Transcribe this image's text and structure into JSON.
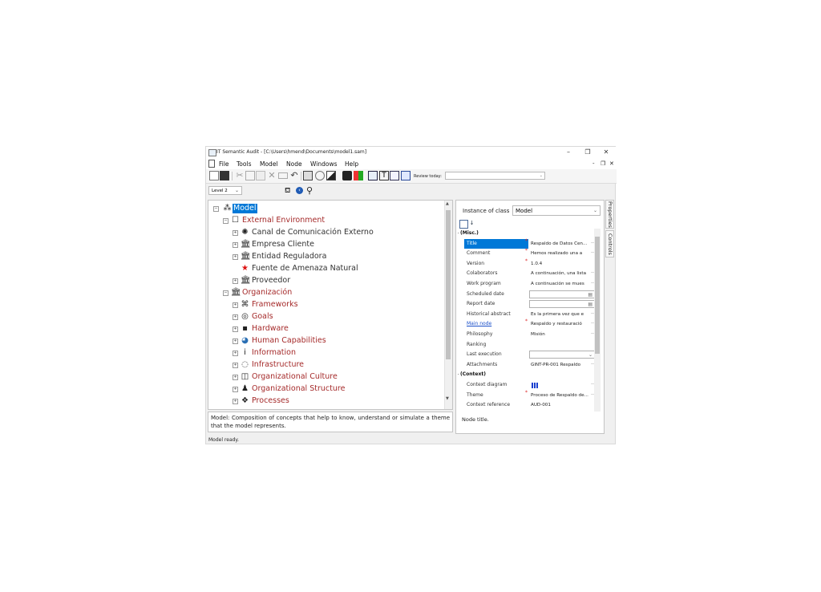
{
  "window": {
    "title": "IT Semantic Audit - [C:\\Users\\hmend\\Documents\\model1.sam]",
    "minimize": "–",
    "restore": "❐",
    "close": "✕"
  },
  "menu": {
    "items": [
      "File",
      "Tools",
      "Model",
      "Node",
      "Windows",
      "Help"
    ],
    "mdi_min": "-",
    "mdi_restore": "❐",
    "mdi_close": "✕"
  },
  "toolbar": {
    "review_label": "Review today:",
    "review_value": ""
  },
  "search": {
    "level": "Level 2"
  },
  "tree": {
    "nodes": [
      {
        "label": "Model",
        "icon": "model-icon",
        "style": "sel"
      },
      {
        "label": "External Environment",
        "icon": "external-env-icon",
        "style": "red"
      },
      {
        "label": "Canal de Comunicación Externo",
        "icon": "communication-channel-icon",
        "style": "dark"
      },
      {
        "label": "Empresa Cliente",
        "icon": "institution-icon",
        "style": "dark"
      },
      {
        "label": "Entidad Reguladora",
        "icon": "institution-icon",
        "style": "dark"
      },
      {
        "label": "Fuente de Amenaza Natural",
        "icon": "star-icon",
        "style": "dark"
      },
      {
        "label": "Proveedor",
        "icon": "institution-icon",
        "style": "dark"
      },
      {
        "label": "Organización",
        "icon": "institution-icon",
        "style": "red"
      },
      {
        "label": "Frameworks",
        "icon": "frameworks-icon",
        "style": "red"
      },
      {
        "label": "Goals",
        "icon": "target-icon",
        "style": "red"
      },
      {
        "label": "Hardware",
        "icon": "hardware-icon",
        "style": "red"
      },
      {
        "label": "Human Capabilities",
        "icon": "human-head-icon",
        "style": "red"
      },
      {
        "label": "Information",
        "icon": "info-icon",
        "style": "red"
      },
      {
        "label": "Infrastructure",
        "icon": "infrastructure-icon",
        "style": "red"
      },
      {
        "label": "Organizational Culture",
        "icon": "culture-icon",
        "style": "red"
      },
      {
        "label": "Organizational Structure",
        "icon": "org-chart-icon",
        "style": "red"
      },
      {
        "label": "Processes",
        "icon": "processes-icon",
        "style": "red"
      }
    ]
  },
  "description": {
    "text": "Model: Composition of concepts that help to know, understand or simulate a theme that the model represents."
  },
  "status": {
    "text": "Model ready."
  },
  "properties": {
    "instance_label": "Instance of class",
    "instance_value": "Model",
    "categories": {
      "misc": "(Misc.)",
      "context": "(Context)"
    },
    "rows": [
      {
        "name": "Title",
        "value": "Respaldo de Datos Cen...",
        "required": true
      },
      {
        "name": "Comment",
        "value": "Hemos realizado una a",
        "required": true
      },
      {
        "name": "Version",
        "value": "1.0.4",
        "required": true
      },
      {
        "name": "Colaborators",
        "value": "A continuación, una lista",
        "required": false
      },
      {
        "name": "Work program",
        "value": "A continuación se mues",
        "required": false
      },
      {
        "name": "Scheduled date",
        "value": "",
        "required": false
      },
      {
        "name": "Report date",
        "value": "",
        "required": false
      },
      {
        "name": "Historical abstract",
        "value": "Es la primera vez que e",
        "required": false
      },
      {
        "name": "Main node",
        "value": "Respaldo y restauració",
        "required": true
      },
      {
        "name": "Philosophy",
        "value": "Misión",
        "required": false
      },
      {
        "name": "Ranking",
        "value": "",
        "required": false
      },
      {
        "name": "Last execution",
        "value": "",
        "required": false
      },
      {
        "name": "Attachments",
        "value": "GINT-PR-001 Respaldo",
        "required": false
      },
      {
        "name": "Context diagram",
        "value": "",
        "required": false
      },
      {
        "name": "Theme",
        "value": "Proceso de Respaldo de...",
        "required": true
      },
      {
        "name": "Context reference",
        "value": "AUD-001",
        "required": false
      }
    ],
    "description": "Node title."
  },
  "side_tabs": [
    "Properties",
    "Controls"
  ],
  "colors": {
    "accent": "#0078d7",
    "concept_red": "#a52a2a"
  }
}
